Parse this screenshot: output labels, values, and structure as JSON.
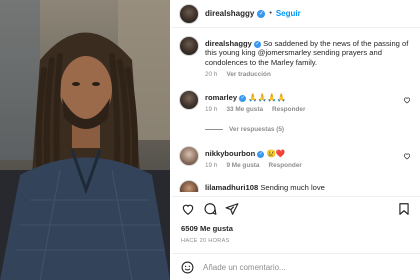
{
  "header": {
    "username": "direalshaggy",
    "follow_label": "Seguir",
    "separator": "•"
  },
  "caption": {
    "username": "direalshaggy",
    "text": "So saddened by the news of the passing of this young king @jomersmarley sending prayers and condolences to the Marley family.",
    "time": "20 h",
    "translate_label": "Ver traducción"
  },
  "comments": [
    {
      "username": "romarley",
      "text": "🙏🙏🙏🙏",
      "time": "19 h",
      "likes": "33 Me gusta",
      "reply_label": "Responder",
      "view_replies": "Ver respuestas (5)"
    },
    {
      "username": "nikkybourbon",
      "text": "😢❤️",
      "time": "19 h",
      "likes": "9 Me gusta",
      "reply_label": "Responder"
    },
    {
      "username": "lilamadhuri108",
      "text": "Sending much love",
      "time": "",
      "likes": "",
      "reply_label": ""
    }
  ],
  "post": {
    "likes": "6509 Me gusta",
    "posted_ago": "HACE 20 HORAS"
  },
  "composer": {
    "placeholder": "Añade un comentario..."
  },
  "colors": {
    "link_blue": "#0095f6",
    "verified_blue": "#3897f0",
    "muted": "#8e8e8e",
    "heart_red": "#ed4956"
  },
  "icons": {
    "like": "heart-outline",
    "comment": "speech-bubble",
    "share": "paper-plane",
    "save": "bookmark",
    "emoji": "smiley-face"
  }
}
